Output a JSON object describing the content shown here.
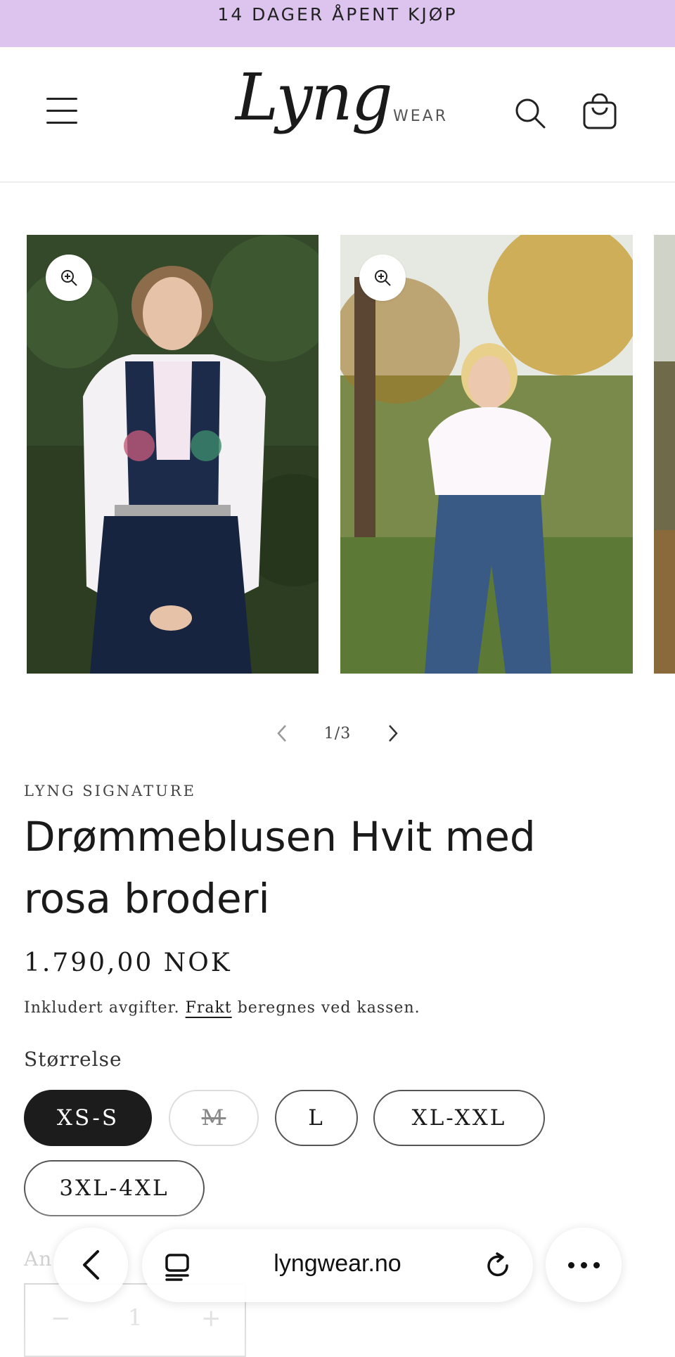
{
  "announcement": "14 DAGER ÅPENT KJØP",
  "header": {
    "logo_main": "Lyng",
    "logo_sub": "WEAR",
    "icons": {
      "menu": "hamburger-menu-icon",
      "search": "search-icon",
      "cart": "shopping-bag-icon"
    }
  },
  "gallery": {
    "counter": "1/3",
    "prev_icon": "chevron-left-icon",
    "next_icon": "chevron-right-icon",
    "zoom_icon": "zoom-in-icon"
  },
  "product": {
    "vendor": "LYNG SIGNATURE",
    "title": "Drømmeblusen Hvit med rosa broderi",
    "price": "1.790,00 NOK",
    "tax_prefix": "Inkludert avgifter.",
    "tax_link": "Frakt",
    "tax_suffix": "beregnes ved kassen.",
    "size_label": "Størrelse",
    "sizes": [
      {
        "label": "XS-S",
        "state": "selected"
      },
      {
        "label": "M",
        "state": "unavailable"
      },
      {
        "label": "L",
        "state": "available"
      },
      {
        "label": "XL-XXL",
        "state": "available"
      },
      {
        "label": "3XL-4XL",
        "state": "available"
      }
    ],
    "quantity_label": "An",
    "quantity": "1",
    "qty_minus": "−",
    "qty_plus": "+"
  },
  "browser": {
    "url": "lyngwear.no",
    "icons": {
      "back": "chevron-left-icon",
      "tabs": "tabs-icon",
      "reload": "reload-icon",
      "more": "more-dots-icon"
    }
  },
  "colors": {
    "announcement_bg": "#dcc4ef",
    "selected_pill": "#1c1c1c"
  }
}
